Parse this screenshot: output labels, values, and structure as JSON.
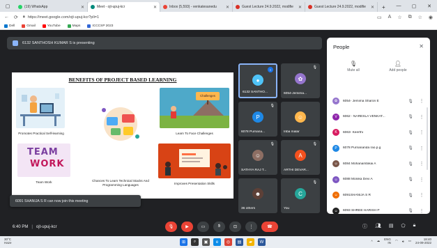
{
  "browser": {
    "tabs": [
      {
        "title": "(19) WhatsApp",
        "color": "#25d366",
        "active": false
      },
      {
        "title": "Meet - ojt-upuj-kcr",
        "color": "#00897b",
        "active": true
      },
      {
        "title": "Inbox (5,593) - venkatesanedu",
        "color": "#ea4335",
        "active": false
      },
      {
        "title": "Guest Lecture 24.9.2022, modifie",
        "color": "#d93025",
        "active": false
      },
      {
        "title": "Guest Lecture 24.9.2022, modifie",
        "color": "#d93025",
        "active": false
      }
    ],
    "url": "https://meet.google.com/ojt-upuj-kcr?pli=1",
    "bookmarks": [
      {
        "label": "Dell",
        "color": "#0076ce"
      },
      {
        "label": "Gmail",
        "color": "#ea4335"
      },
      {
        "label": "YouTube",
        "color": "#ff0000"
      },
      {
        "label": "Maps",
        "color": "#34a853"
      },
      {
        "label": "ICCCSP 2023",
        "color": "#3367d6"
      }
    ]
  },
  "meet": {
    "presenting_text": "6132 SANTHOSH KUMAR S is presenting",
    "slide": {
      "title": "BENEFITS OF PROJECT BASED LEARNING",
      "captions": {
        "c1": "Promotes Practical Self-learning",
        "c2": "Chances To Learn Technical Stacks And Programming Languages",
        "c3": "Learn To Face Challenges",
        "c4": "Team Work",
        "c5": "Improves Presentation Skills",
        "challenges_sign": "Challenges",
        "team_word": "TEAM",
        "work_word": "WORK"
      }
    },
    "tiles": [
      {
        "name": "6132 SANTHO...",
        "initial": "",
        "color": "#4fc3f7",
        "state": "speaking"
      },
      {
        "name": "6054-Jemima...",
        "initial": "",
        "color": "#9575cd",
        "state": "muted"
      },
      {
        "name": "6078 Purnana...",
        "initial": "P",
        "color": "#1e88e5",
        "state": "muted"
      },
      {
        "name": "Inba malar",
        "initial": "",
        "color": "#ffb74d",
        "state": "none"
      },
      {
        "name": "SATHYA RAJ T...",
        "initial": "",
        "color": "#8d6e63",
        "state": "muted"
      },
      {
        "name": "ARTHI DEVAR...",
        "initial": "A",
        "color": "#f4511e",
        "state": "muted"
      },
      {
        "name": "36 others",
        "initial": "",
        "color": "#5d4037",
        "state": "none"
      },
      {
        "name": "You",
        "initial": "C",
        "color": "#26a69a",
        "state": "muted"
      }
    ],
    "toast": "6091 SHANIJA S R can now join this meeting",
    "time": "6:40 PM",
    "meeting_code": "ojt-upuj-kcr"
  },
  "people": {
    "header": "People",
    "mute_all": "Mute all",
    "add_people": "Add people",
    "list": [
      {
        "name": "6054- Jemima Sharon E",
        "color": "#9575cd",
        "initial": ""
      },
      {
        "name": "6062 - NARESLA VENKAT...",
        "color": "#8e24aa",
        "initial": "V"
      },
      {
        "name": "6063- Keerthi",
        "color": "#d81b60",
        "initial": "K"
      },
      {
        "name": "6078 Purnananda rao.p.g",
        "color": "#1e88e5",
        "initial": "P"
      },
      {
        "name": "6084 Mohanambikai A",
        "color": "#795548",
        "initial": ""
      },
      {
        "name": "6088 Monika Devi A",
        "color": "#7e57c2",
        "initial": ""
      },
      {
        "name": "6091SHANIJA S R",
        "color": "#ef6c00",
        "initial": ""
      },
      {
        "name": "6093 SHREE HARISH P",
        "color": "#212121",
        "initial": ""
      }
    ]
  },
  "taskbar": {
    "weather_temp": "30°C",
    "weather_desc": "Haze",
    "lang": "ENG",
    "region": "IN",
    "clock_time": "18:40",
    "clock_date": "24-09-2022"
  }
}
